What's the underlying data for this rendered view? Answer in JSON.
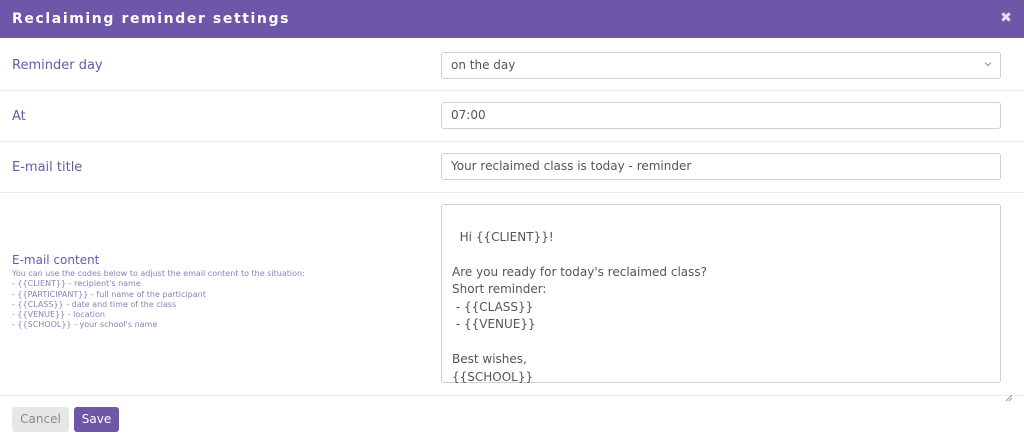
{
  "dialog": {
    "title": "Reclaiming reminder settings",
    "close_glyph": "✖"
  },
  "fields": {
    "reminder_day": {
      "label": "Reminder day",
      "value": "on the day"
    },
    "at": {
      "label": "At",
      "value": "07:00"
    },
    "email_title": {
      "label": "E-mail title",
      "value": "Your reclaimed class is today - reminder"
    },
    "email_content": {
      "label": "E-mail content",
      "hints": [
        "You can use the codes below to adjust the email content to the situation:",
        "- {{CLIENT}} - recipient's name",
        "- {{PARTICIPANT}} - full name of the participant",
        "- {{CLASS}} - date and time of the class",
        "- {{VENUE}} - location",
        "- {{SCHOOL}} - your school's name"
      ],
      "value": "Hi {{CLIENT}}!\n\nAre you ready for today's reclaimed class?\nShort reminder:\n - {{CLASS}}\n - {{VENUE}}\n\nBest wishes,\n{{SCHOOL}}"
    }
  },
  "buttons": {
    "cancel": "Cancel",
    "save": "Save"
  },
  "icons": {
    "close": "close-icon",
    "chevron": "chevron-down-icon",
    "resize": "resize-grip-icon"
  },
  "colors": {
    "accent": "#6e56a8",
    "label": "#6e56a8",
    "hint": "#8c7fb8"
  }
}
